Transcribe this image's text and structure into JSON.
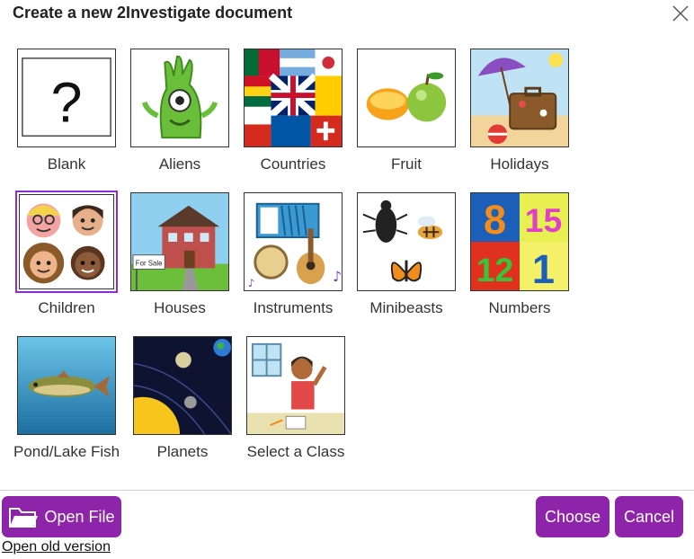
{
  "dialog": {
    "title": "Create a new 2Investigate document",
    "close_icon": "close-icon"
  },
  "templates": [
    {
      "label": "Blank",
      "icon": "question-mark-icon"
    },
    {
      "label": "Aliens",
      "icon": "alien-icon"
    },
    {
      "label": "Countries",
      "icon": "flags-icon"
    },
    {
      "label": "Fruit",
      "icon": "fruit-icon"
    },
    {
      "label": "Holidays",
      "icon": "beach-suitcase-icon"
    },
    {
      "label": "Children",
      "icon": "children-faces-icon",
      "selected": true
    },
    {
      "label": "Houses",
      "icon": "house-for-sale-icon"
    },
    {
      "label": "Instruments",
      "icon": "instruments-icon"
    },
    {
      "label": "Minibeasts",
      "icon": "minibeasts-icon"
    },
    {
      "label": "Numbers",
      "icon": "numbers-icon"
    },
    {
      "label": "Pond/Lake Fish",
      "icon": "fish-icon"
    },
    {
      "label": "Planets",
      "icon": "planets-icon"
    },
    {
      "label": "Select a Class",
      "icon": "classroom-icon"
    }
  ],
  "house_sign": "For Sale",
  "number_tiles": [
    "8",
    "15",
    "12",
    "1"
  ],
  "footer": {
    "open_file_label": "Open File",
    "choose_label": "Choose",
    "cancel_label": "Cancel",
    "old_version_label": "Open old version"
  },
  "colors": {
    "accent": "#8e24aa",
    "selection": "#8f2ad6"
  }
}
